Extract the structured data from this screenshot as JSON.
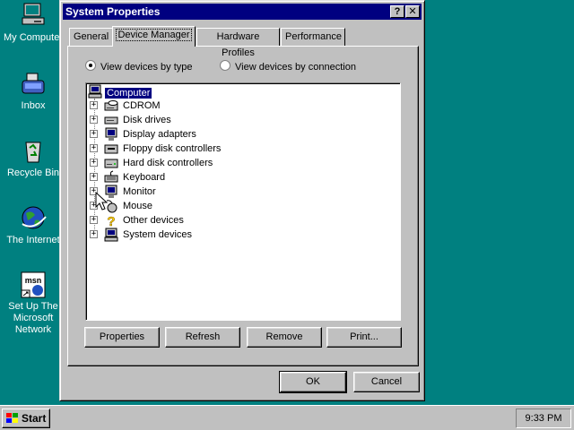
{
  "desktop": {
    "icons": [
      {
        "label": "My Computer",
        "icon": "my-computer-icon"
      },
      {
        "label": "Inbox",
        "icon": "inbox-icon"
      },
      {
        "label": "Recycle Bin",
        "icon": "recycle-bin-icon"
      },
      {
        "label": "The Internet",
        "icon": "internet-icon"
      },
      {
        "label": "Set Up The Microsoft Network",
        "icon": "msn-setup-icon"
      }
    ]
  },
  "window": {
    "title": "System Properties",
    "help_button": "?",
    "close_button": "✕",
    "tabs": [
      "General",
      "Device Manager",
      "Hardware Profiles",
      "Performance"
    ],
    "active_tab": "Device Manager",
    "view_options": [
      {
        "label": "View devices by type",
        "checked": true
      },
      {
        "label": "View devices by connection",
        "checked": false
      }
    ],
    "tree": {
      "root": "Computer",
      "items": [
        {
          "label": "CDROM",
          "icon": "cdrom-icon"
        },
        {
          "label": "Disk drives",
          "icon": "disk-drive-icon"
        },
        {
          "label": "Display adapters",
          "icon": "display-adapter-icon"
        },
        {
          "label": "Floppy disk controllers",
          "icon": "floppy-controller-icon"
        },
        {
          "label": "Hard disk controllers",
          "icon": "hard-disk-controller-icon"
        },
        {
          "label": "Keyboard",
          "icon": "keyboard-icon"
        },
        {
          "label": "Monitor",
          "icon": "monitor-icon"
        },
        {
          "label": "Mouse",
          "icon": "mouse-icon"
        },
        {
          "label": "Other devices",
          "icon": "question-icon"
        },
        {
          "label": "System devices",
          "icon": "system-devices-icon"
        }
      ]
    },
    "panel_buttons": [
      "Properties",
      "Refresh",
      "Remove",
      "Print..."
    ],
    "ok_button": "OK",
    "cancel_button": "Cancel"
  },
  "taskbar": {
    "start_label": "Start",
    "clock": "9:33 PM"
  },
  "colors": {
    "desktop": "#008080",
    "titlebar": "#000080",
    "face": "#c0c0c0",
    "selection": "#000080"
  }
}
